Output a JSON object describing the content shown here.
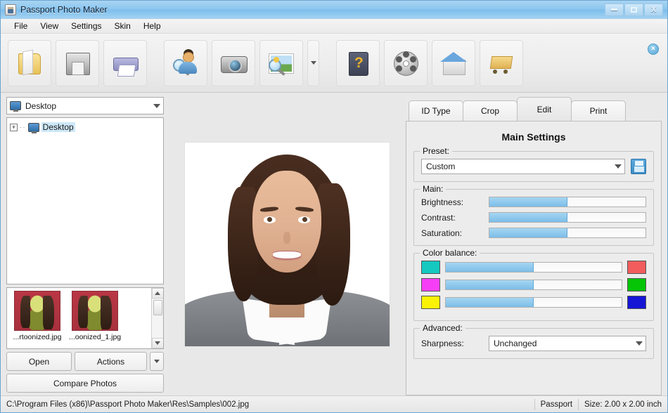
{
  "window": {
    "title": "Passport Photo Maker",
    "app_icon": "app-icon",
    "minimize_label": "",
    "maximize_label": "",
    "close_label": "X"
  },
  "menu": {
    "items": [
      {
        "label": "File"
      },
      {
        "label": "View"
      },
      {
        "label": "Settings"
      },
      {
        "label": "Skin"
      },
      {
        "label": "Help"
      }
    ]
  },
  "toolbar": {
    "buttons": [
      {
        "icon": "open-folder-icon"
      },
      {
        "icon": "save-floppy-icon"
      },
      {
        "icon": "print-icon"
      },
      {
        "icon": "person-search-icon"
      },
      {
        "icon": "camera-icon"
      },
      {
        "icon": "image-search-icon"
      }
    ],
    "dropdown_icon": "chevron-down-icon",
    "buttons_right": [
      {
        "icon": "help-book-icon"
      },
      {
        "icon": "film-reel-icon"
      },
      {
        "icon": "home-icon"
      },
      {
        "icon": "shopping-cart-icon"
      }
    ],
    "close_button_label": "×"
  },
  "left_panel": {
    "folder_combo": {
      "value": "Desktop",
      "icon": "monitor-icon",
      "caret_icon": "chevron-down-icon"
    },
    "tree": {
      "expand_label": "+",
      "dots": "··",
      "node_label": "Desktop",
      "node_icon": "monitor-icon"
    },
    "thumbnails": [
      {
        "name": "...rtoonized.jpg"
      },
      {
        "name": "...oonized_1.jpg"
      }
    ],
    "buttons": {
      "open": "Open",
      "actions": "Actions",
      "actions_caret": "chevron-down-icon",
      "compare": "Compare Photos"
    }
  },
  "center": {
    "photo_alt": "passport-photo-preview"
  },
  "right_panel": {
    "tabs": [
      {
        "label": "ID Type",
        "active": false
      },
      {
        "label": "Crop",
        "active": false
      },
      {
        "label": "Edit",
        "active": true
      },
      {
        "label": "Print",
        "active": false
      }
    ],
    "panel_title": "Main Settings",
    "preset": {
      "legend": "Preset:",
      "value": "Custom",
      "caret_icon": "chevron-down-icon",
      "save_icon": "save-preset-icon"
    },
    "main": {
      "legend": "Main:",
      "sliders": [
        {
          "label": "Brightness:",
          "value": 50
        },
        {
          "label": "Contrast:",
          "value": 50
        },
        {
          "label": "Saturation:",
          "value": 50
        }
      ]
    },
    "color_balance": {
      "legend": "Color balance:",
      "rows": [
        {
          "left_color": "#15c8c0",
          "right_color": "#f25c5c",
          "value": 50
        },
        {
          "left_color": "#f63ef6",
          "right_color": "#06c406",
          "value": 50
        },
        {
          "left_color": "#fbf307",
          "right_color": "#1515d6",
          "value": 50
        }
      ]
    },
    "advanced": {
      "legend": "Advanced:",
      "sharpness_label": "Sharpness:",
      "sharpness_value": "Unchanged",
      "caret_icon": "chevron-down-icon"
    }
  },
  "status_bar": {
    "path": "C:\\Program Files (x86)\\Passport Photo Maker\\Res\\Samples\\002.jpg",
    "doc_type": "Passport",
    "size": "Size: 2.00 x 2.00 inch"
  },
  "colors": {
    "accent": "#7cbde8",
    "title_bar": "#8cc6ee",
    "panel_bg": "#ececec"
  }
}
